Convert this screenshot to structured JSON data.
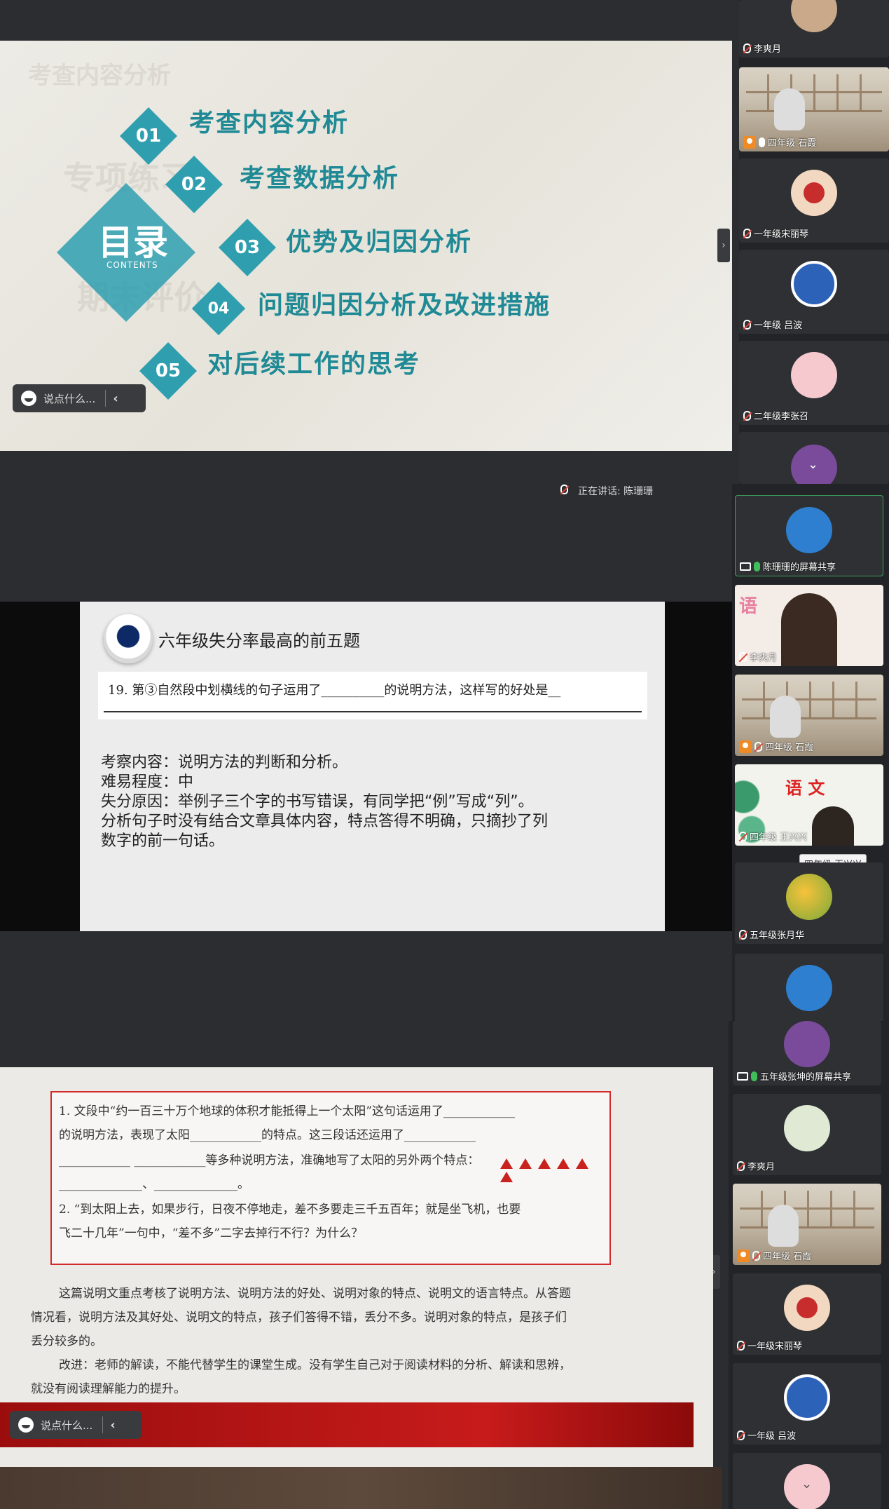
{
  "panel1": {
    "slide": {
      "watermark_title": "考查内容分析",
      "watermark_2": "专项练习",
      "watermark_3": "期末评价",
      "center_title": "目录",
      "center_sub": "CONTENTS",
      "items": [
        {
          "num": "01",
          "text": "考查内容分析"
        },
        {
          "num": "02",
          "text": "考查数据分析"
        },
        {
          "num": "03",
          "text": "优势及归因分析"
        },
        {
          "num": "04",
          "text": "问题归因分析及改进措施"
        },
        {
          "num": "05",
          "text": "对后续工作的思考"
        }
      ]
    },
    "chat_placeholder": "说点什么...",
    "sidebar": [
      {
        "name": "李爽月"
      },
      {
        "name": "四年级 石霞"
      },
      {
        "name": "一年级宋丽琴"
      },
      {
        "name": "一年级 吕波"
      },
      {
        "name": "二年级李张召"
      }
    ]
  },
  "panel2": {
    "speaking_label": "正在讲话: 陈珊珊",
    "slide": {
      "title": "六年级失分率最高的前五题",
      "question": "19. 第③自然段中划横线的句子运用了__________的说明方法，这样写的好处是__",
      "lines": [
        "考察内容：说明方法的判断和分析。",
        "难易程度：中",
        "失分原因：举例子三个字的书写错误，有同学把“例”写成“列”。",
        "分析句子时没有结合文章具体内容，特点答得不明确，只摘抄了列",
        "数字的前一句话。"
      ]
    },
    "sidebar": [
      {
        "name": "陈珊珊的屏幕共享"
      },
      {
        "name": "李爽月",
        "bg_text": "语"
      },
      {
        "name": "四年级 石霞"
      },
      {
        "name": "四年级 王兴兴",
        "bg_text": "语 文"
      },
      {
        "name": "五年级张月华"
      },
      {
        "name": ""
      }
    ],
    "tooltip": "四年级 王兴兴"
  },
  "panel3": {
    "slide": {
      "q_lines": [
        "1. 文段中“约一百三十万个地球的体积才能抵得上一个太阳”这句话运用了____________",
        "的说明方法，表现了太阳____________的特点。这三段话还运用了____________",
        "____________  ____________等多种说明方法，准确地写了太阳的另外两个特点：",
        "______________、______________。",
        "2. “到太阳上去，如果步行，日夜不停地走，差不多要走三千五百年；就是坐飞机，也要",
        "飞二十几年”一句中，“差不多”二字去掉行不行？为什么？"
      ],
      "paras": [
        "这篇说明文重点考核了说明方法、说明方法的好处、说明对象的特点、说明文的语言特点。从答题",
        "情况看，说明方法及其好处、说明文的特点，孩子们答得不错，丢分不多。说明对象的特点，是孩子们",
        "丢分较多的。",
        "改进：老师的解读，不能代替学生的课堂生成。没有学生自己对于阅读材料的分析、解读和思辨，",
        "就没有阅读理解能力的提升。"
      ],
      "triangles": 6
    },
    "chat_placeholder": "说点什么...",
    "sidebar": [
      {
        "name": "五年级张坤的屏幕共享"
      },
      {
        "name": "李爽月"
      },
      {
        "name": "四年级 石霞"
      },
      {
        "name": "一年级宋丽琴"
      },
      {
        "name": "一年级 吕波"
      }
    ]
  },
  "colors": {
    "teal": "#2f9fb0",
    "toc_text": "#1f8a95",
    "dark_bg": "#2b2d30",
    "red_accent": "#c9211d"
  }
}
